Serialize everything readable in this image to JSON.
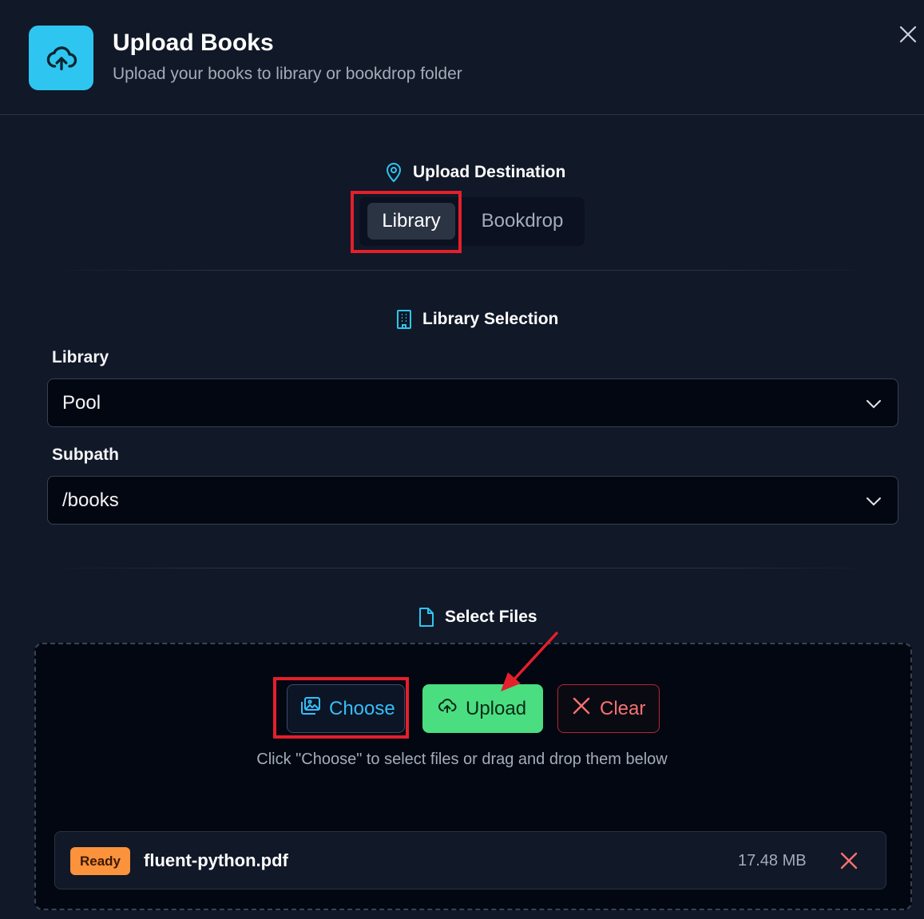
{
  "header": {
    "title": "Upload Books",
    "subtitle": "Upload your books to library or bookdrop folder",
    "icon": "cloud-upload-icon",
    "accent": "#2ec6f0"
  },
  "destination": {
    "heading": "Upload Destination",
    "icon": "map-pin-icon",
    "options": [
      "Library",
      "Bookdrop"
    ],
    "selected": "Library"
  },
  "library_selection": {
    "heading": "Library Selection",
    "icon": "building-icon",
    "library_label": "Library",
    "library_value": "Pool",
    "subpath_label": "Subpath",
    "subpath_value": "/books"
  },
  "files": {
    "heading": "Select Files",
    "icon": "file-icon",
    "buttons": {
      "choose": "Choose",
      "upload": "Upload",
      "clear": "Clear"
    },
    "hint": "Click \"Choose\" to select files or drag and drop them below",
    "items": [
      {
        "status": "Ready",
        "name": "fluent-python.pdf",
        "size": "17.48 MB"
      }
    ]
  },
  "colors": {
    "background": "#111827",
    "upload_green": "#4ade80",
    "clear_red": "#f87171",
    "ready_orange": "#fb923c",
    "annotation_red": "#e3202b"
  }
}
